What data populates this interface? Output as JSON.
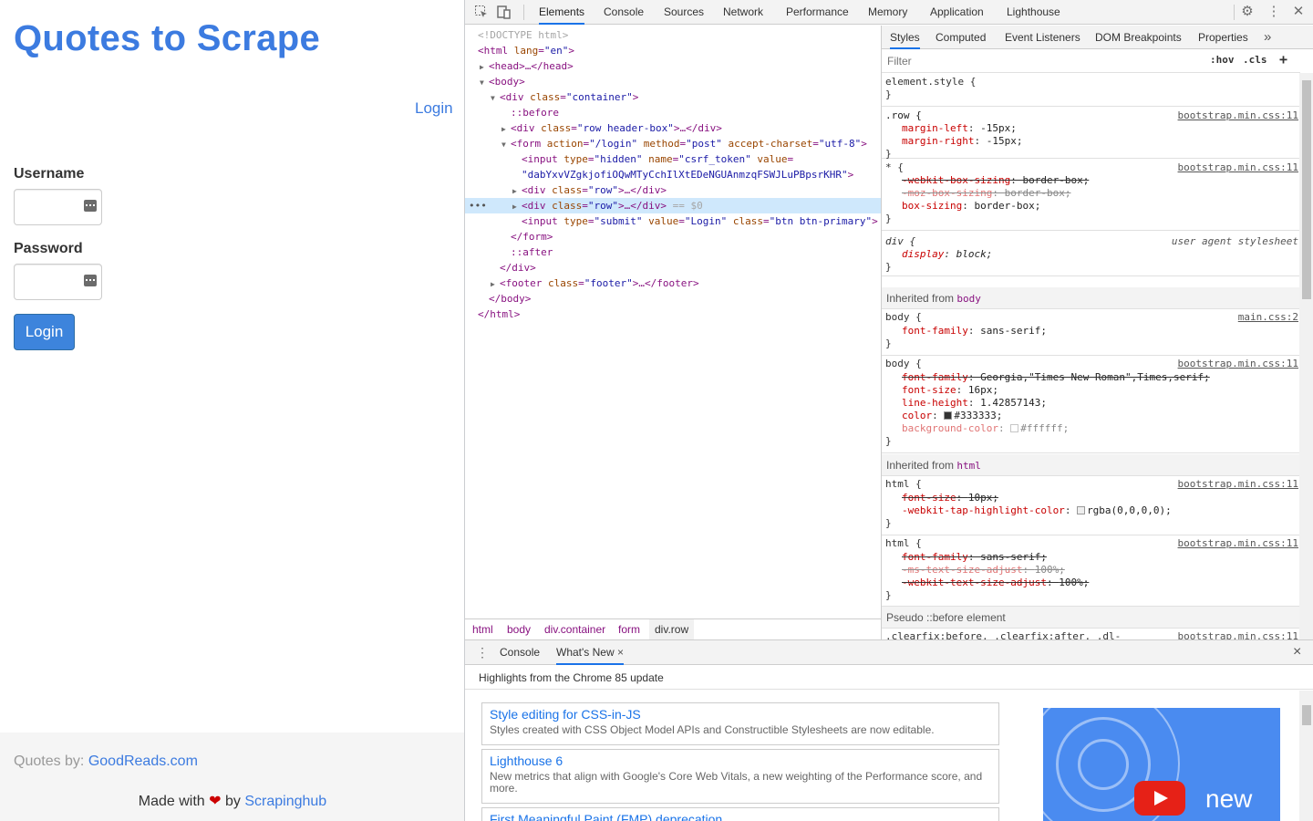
{
  "site": {
    "title": "Quotes to Scrape",
    "login_link": "Login",
    "username_label": "Username",
    "password_label": "Password",
    "username_value": "",
    "password_value": "",
    "login_button": "Login",
    "footer_quotes_prefix": "Quotes by: ",
    "footer_quotes_link": "GoodReads.com",
    "footer_made_prefix": "Made with ",
    "footer_heart": "❤",
    "footer_made_by": " by ",
    "footer_made_link": "Scrapinghub"
  },
  "devtools": {
    "tabs": [
      "Elements",
      "Console",
      "Sources",
      "Network",
      "Performance",
      "Memory",
      "Application",
      "Lighthouse"
    ],
    "active_tab": "Elements",
    "more_tabs_icon": "»",
    "elements_tree": {
      "doctype": "<!DOCTYPE html>",
      "html_open": "<html",
      "html_lang_attr": "lang",
      "html_lang_val": "\"en\"",
      "head": "<head>…</head>",
      "body_open": "<body>",
      "container_open": "<div",
      "container_attr": "class",
      "container_val": "\"container\"",
      "before": "::before",
      "header_row_attr_val": "\"row header-box\"",
      "form_action_val": "\"/login\"",
      "form_method_val": "\"post\"",
      "form_charset_val": "\"utf-8\"",
      "csrf_type_val": "\"hidden\"",
      "csrf_name_val": "\"csrf_token\"",
      "csrf_value": "\"dabYxvVZgkjofiOQwMTyCchIlXtEDeNGUAnmzqFSWJLuPBpsrKHR\"",
      "row_val": "\"row\"",
      "selected_marker": "== $0",
      "submit_type_val": "\"submit\"",
      "submit_value_val": "\"Login\"",
      "submit_class_val": "\"btn btn-primary\"",
      "form_close": "</form>",
      "after": "::after",
      "div_close": "</div>",
      "footer_val": "\"footer\"",
      "body_close": "</body>",
      "html_close": "</html>"
    },
    "breadcrumbs": [
      "html",
      "body",
      "div.container",
      "form",
      "div.row"
    ],
    "styles_tabs": [
      "Styles",
      "Computed",
      "Event Listeners",
      "DOM Breakpoints",
      "Properties"
    ],
    "filter_placeholder": "Filter",
    "hov": ":hov",
    "cls": ".cls",
    "plus": "+",
    "rules": {
      "element_style": "element.style {",
      "close": "}",
      "row_selector": ".row {",
      "row_src": "bootstrap.min.css:11",
      "row_props": [
        [
          "margin-left",
          "-15px;"
        ],
        [
          "margin-right",
          "-15px;"
        ]
      ],
      "star_selector": "* {",
      "star_src": "bootstrap.min.css:11",
      "star_props": [
        [
          "-webkit-box-sizing",
          "border-box;"
        ],
        [
          "-moz-box-sizing",
          "border-box;"
        ],
        [
          "box-sizing",
          "border-box;"
        ]
      ],
      "div_selector": "div {",
      "div_src": "user agent stylesheet",
      "div_props": [
        [
          "display",
          "block;"
        ]
      ],
      "inherited_body": "Inherited from ",
      "inherited_body_tag": "body",
      "body1_selector": "body {",
      "body1_src": "main.css:2",
      "body1_props": [
        [
          "font-family",
          "sans-serif;"
        ]
      ],
      "body2_selector": "body {",
      "body2_src": "bootstrap.min.css:11",
      "body2_props": [
        [
          "font-family",
          "Georgia,\"Times New Roman\",Times,serif;"
        ],
        [
          "font-size",
          "16px;"
        ],
        [
          "line-height",
          "1.42857143;"
        ],
        [
          "color",
          "#333333;"
        ],
        [
          "background-color",
          "#ffffff;"
        ]
      ],
      "inherited_html": "Inherited from ",
      "inherited_html_tag": "html",
      "html1_selector": "html {",
      "html1_src": "bootstrap.min.css:11",
      "html1_props": [
        [
          "font-size",
          "10px;"
        ],
        [
          "-webkit-tap-highlight-color",
          "rgba(0,0,0,0);"
        ]
      ],
      "html2_selector": "html {",
      "html2_src": "bootstrap.min.css:11",
      "html2_props": [
        [
          "font-family",
          "sans-serif;"
        ],
        [
          "-ms-text-size-adjust",
          "100%;"
        ],
        [
          "-webkit-text-size-adjust",
          "100%;"
        ]
      ],
      "pseudo_before": "Pseudo ::before element",
      "clearfix_selector": ".clearfix:before, .clearfix:after, .dl-",
      "clearfix_src": "bootstrap.min.css:11"
    },
    "colors": {
      "accent": "#1a73e8",
      "swatch_333": "#333333",
      "swatch_fff": "#ffffff"
    },
    "drawer": {
      "tabs": [
        "Console",
        "What's New"
      ],
      "close_tab": "×",
      "close": "×",
      "heading": "Highlights from the Chrome 85 update",
      "cards": [
        {
          "title": "Style editing for CSS-in-JS",
          "desc": "Styles created with CSS Object Model APIs and Constructible Stylesheets are now editable."
        },
        {
          "title": "Lighthouse 6",
          "desc": "New metrics that align with Google's Core Web Vitals, a new weighting of the Performance score, and more."
        },
        {
          "title": "First Meaningful Paint (FMP) deprecation",
          "desc": ""
        }
      ],
      "video_text": "new"
    }
  }
}
